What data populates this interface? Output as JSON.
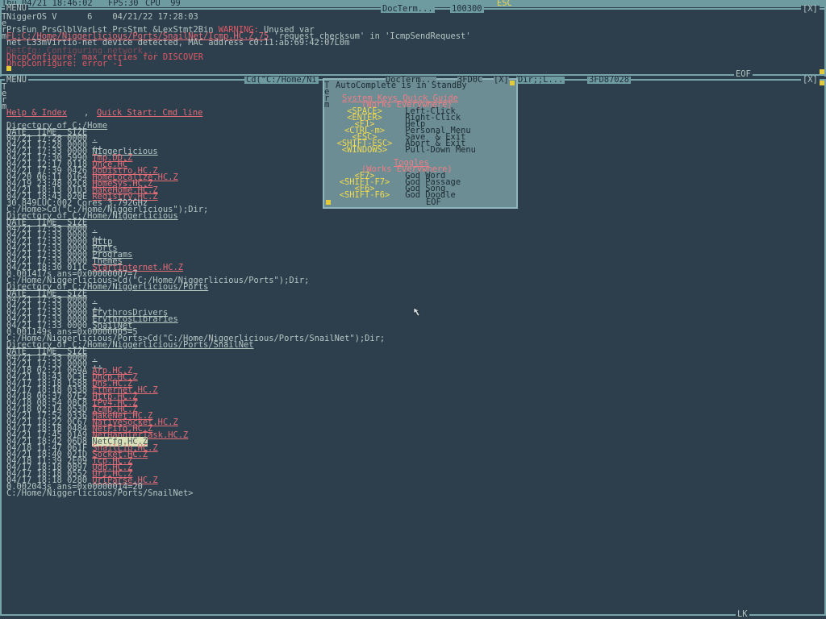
{
  "system_bar": {
    "clock": "Thu 04/21 18:46:02",
    "fps": "FPS:30",
    "cpu": "CPU  99",
    "esc": "ESC"
  },
  "top_window": {
    "menu": "MENU",
    "title": "DocTerm...",
    "code": "100300",
    "close": "[X]",
    "eof": "EOF",
    "side_letters": [
      "T",
      "e",
      "r",
      "m"
    ],
    "lines": [
      {
        "text": "NiggerOS V      6    04/21/22 17:28:03"
      },
      {
        "text": "PrsFun PrsGlblVarLst PrsStmt &LexStmt2Bin ",
        "warn": "WARNING:",
        "rest": " Unused var"
      },
      {
        "file": "FL:C:/Home/Niggerlicious/Ports/SnailNet/Icmp.HC.Z,75",
        "rest": " 'request_checksum' in 'IcmpSendRequest'"
      },
      {
        "text": "net L33mVirtio-net device detected, MAC address c0:11:ab:69:42:07L0m"
      },
      {
        "red": "DetCfg: Configuring network..."
      },
      {
        "red": "DhcpConfigure: max retries for DISCOVER"
      },
      {
        "red": "DhcpConfigure: error -1"
      }
    ]
  },
  "main_window": {
    "menu": "MENU",
    "title": "Cd(\"C:/Home/Ni",
    "dir_title": "Dir;;L...",
    "addr1": "3FD0C",
    "addr2": "3FD87028",
    "close": "[X]",
    "help_link": "Help & Index",
    "quick_link": "Quick Start: Cmd line",
    "side_letters": [
      "T",
      "e",
      "r",
      "m"
    ]
  },
  "listing": {
    "blocks": [
      {
        "header": "Directory of C:/Home",
        "cols": "DATE_ TIME_ SIZE",
        "rows": [
          [
            "04/21 17:28 0000 ",
            "."
          ],
          [
            "04/21 17:28 0000 ",
            ".."
          ],
          [
            "04/21 17:33 0000 ",
            "Niggerlicious"
          ],
          [
            "04/21 17:30 5990 ",
            "Tmp.DD.Z"
          ],
          [
            "04/21 12:17 0118 ",
            "Once.HC"
          ],
          [
            "04/21 17:39 0426 ",
            "DoDistro.HC.Z"
          ],
          [
            "04/20 06:11 0164 ",
            "HomeLocalize.HC.Z"
          ],
          [
            "04/19 23:48 02C8 ",
            "HomeSys.HC.Z"
          ],
          [
            "04/21 18:13 01D3 ",
            "MakeHome.HC.Z"
          ],
          [
            "04/21 18:43 020E ",
            "Registry.HC.Z"
          ]
        ],
        "footer": "30.849LUC:002 Cores 3.792GHz",
        "prompt": "C:/Home>Cd(\"C:/Home/Niggerlicious\");Dir;"
      },
      {
        "header": "Directory of C:/Home/Niggerlicious",
        "cols": "DATE_ TIME_ SIZE",
        "rows": [
          [
            "04/21 17:33 0000 ",
            "."
          ],
          [
            "04/21 17:33 0000 ",
            ".."
          ],
          [
            "04/21 17:33 0000 ",
            "Http"
          ],
          [
            "04/21 17:33 0000 ",
            "Ports"
          ],
          [
            "04/21 17:33 0000 ",
            "Programs"
          ],
          [
            "04/21 17:33 0000 ",
            "Themes"
          ],
          [
            "04/21 18:30 011C ",
            "StartInternet.HC.Z"
          ]
        ],
        "footer": "0.001417s ans=0x00000007=7",
        "prompt": "C:/Home/Niggerlicious>Cd(\"C:/Home/Niggerlicious/Ports\");Dir;"
      },
      {
        "header": "Directory of C:/Home/Niggerlicious/Ports",
        "cols": "DATE_ TIME_ SIZE",
        "rows": [
          [
            "04/21 17:33 0000 ",
            "."
          ],
          [
            "04/21 17:33 0000 ",
            ".."
          ],
          [
            "04/21 17:33 0000 ",
            "ErythrosDrivers"
          ],
          [
            "04/21 17:33 0000 ",
            "ErythrosLibraries"
          ],
          [
            "04/21 17:33 0000 ",
            "SnailNet"
          ]
        ],
        "footer": "0.001149s ans=0x00000005=5",
        "prompt": "C:/Home/Niggerlicious/Ports>Cd(\"C:/Home/Niggerlicious/Ports/SnailNet\");Dir;"
      },
      {
        "header": "Directory of C:/Home/Niggerlicious/Ports/SnailNet",
        "cols": "DATE_ TIME_ SIZE",
        "rows": [
          [
            "04/21 17:33 0000 ",
            "."
          ],
          [
            "04/21 17:33 0000 ",
            ".."
          ],
          [
            "04/18 02:21 069A ",
            "Arp.HC.Z"
          ],
          [
            "04/21 18:43 0C3E ",
            "Dhcp.HC.Z"
          ],
          [
            "04/17 18:18 1588 ",
            "Dns.HC.Z"
          ],
          [
            "04/17 18:18 0338 ",
            "Ethernet.HC.Z"
          ],
          [
            "04/18 06:37 07E2 ",
            "Http.HC.Z"
          ],
          [
            "04/18 08:54 08C8 ",
            "IPv4.HC.Z"
          ],
          [
            "04/18 02:14 053D ",
            "Icmp.HC.Z"
          ],
          [
            "04/21 17:52 0336 ",
            "MakeNet.HC.Z"
          ],
          [
            "04/21 18:22 0C67 ",
            "NativeSocket.HC.Z"
          ],
          [
            "04/17 18:18 0484 ",
            "NetFifo.HC.Z"
          ],
          [
            "04/21 17:45 01A9 ",
            "NetHandlerTask.HC.Z"
          ],
          [
            "04/21 18:42 06D8 ",
            "NetCfg.HC.Z"
          ],
          [
            "04/18 11:47 061F ",
            "SnailLib.HC.Z"
          ],
          [
            "04/21 18:40 021D ",
            "Socket.HC.Z"
          ],
          [
            "04/18 11:39 2E09 ",
            "Tcp.HC.Z"
          ],
          [
            "04/17 18:18 0897 ",
            "Udp.HC.Z"
          ],
          [
            "04/17 18:18 0552 ",
            "Uri.HC.Z"
          ],
          [
            "04/17 18:18 0280 ",
            "UrlParse.HC.Z"
          ]
        ],
        "footer": "0.002043s ans=0x00000014=20",
        "prompt": "C:/Home/Niggerlicious/Ports/SnailNet>"
      }
    ]
  },
  "popup": {
    "title": "DocTerm...",
    "addr": "3FD0C",
    "close": "[X]",
    "status": "AutoComplete is in StandBy",
    "section1": "System Keys Quick Guide",
    "section1_sub": "(Works Everywhere)",
    "keys1": [
      [
        "<SPACE>",
        "Left-Click"
      ],
      [
        "<ENTER>",
        "Right-Click"
      ],
      [
        "<F1>",
        "Help"
      ],
      [
        "<CTRL-m>",
        "Personal Menu"
      ],
      [
        "<ESC>",
        "Save  & Exit"
      ],
      [
        "<SHIFT-ESC>",
        "Abort & Exit"
      ],
      [
        "<WINDOWS>",
        "Pull-Down Menu"
      ]
    ],
    "section2": "Toggles",
    "section2_sub": "(Works Everywhere)",
    "keys2": [
      [
        "<F7>",
        "God Word"
      ],
      [
        "<SHIFT-F7>",
        "God Passage"
      ],
      [
        "<F6>",
        "God Song"
      ],
      [
        "<SHIFT-F6>",
        "God Doodle"
      ]
    ],
    "eof": "EOF"
  },
  "bottom_bar": {
    "lk": "LK"
  }
}
